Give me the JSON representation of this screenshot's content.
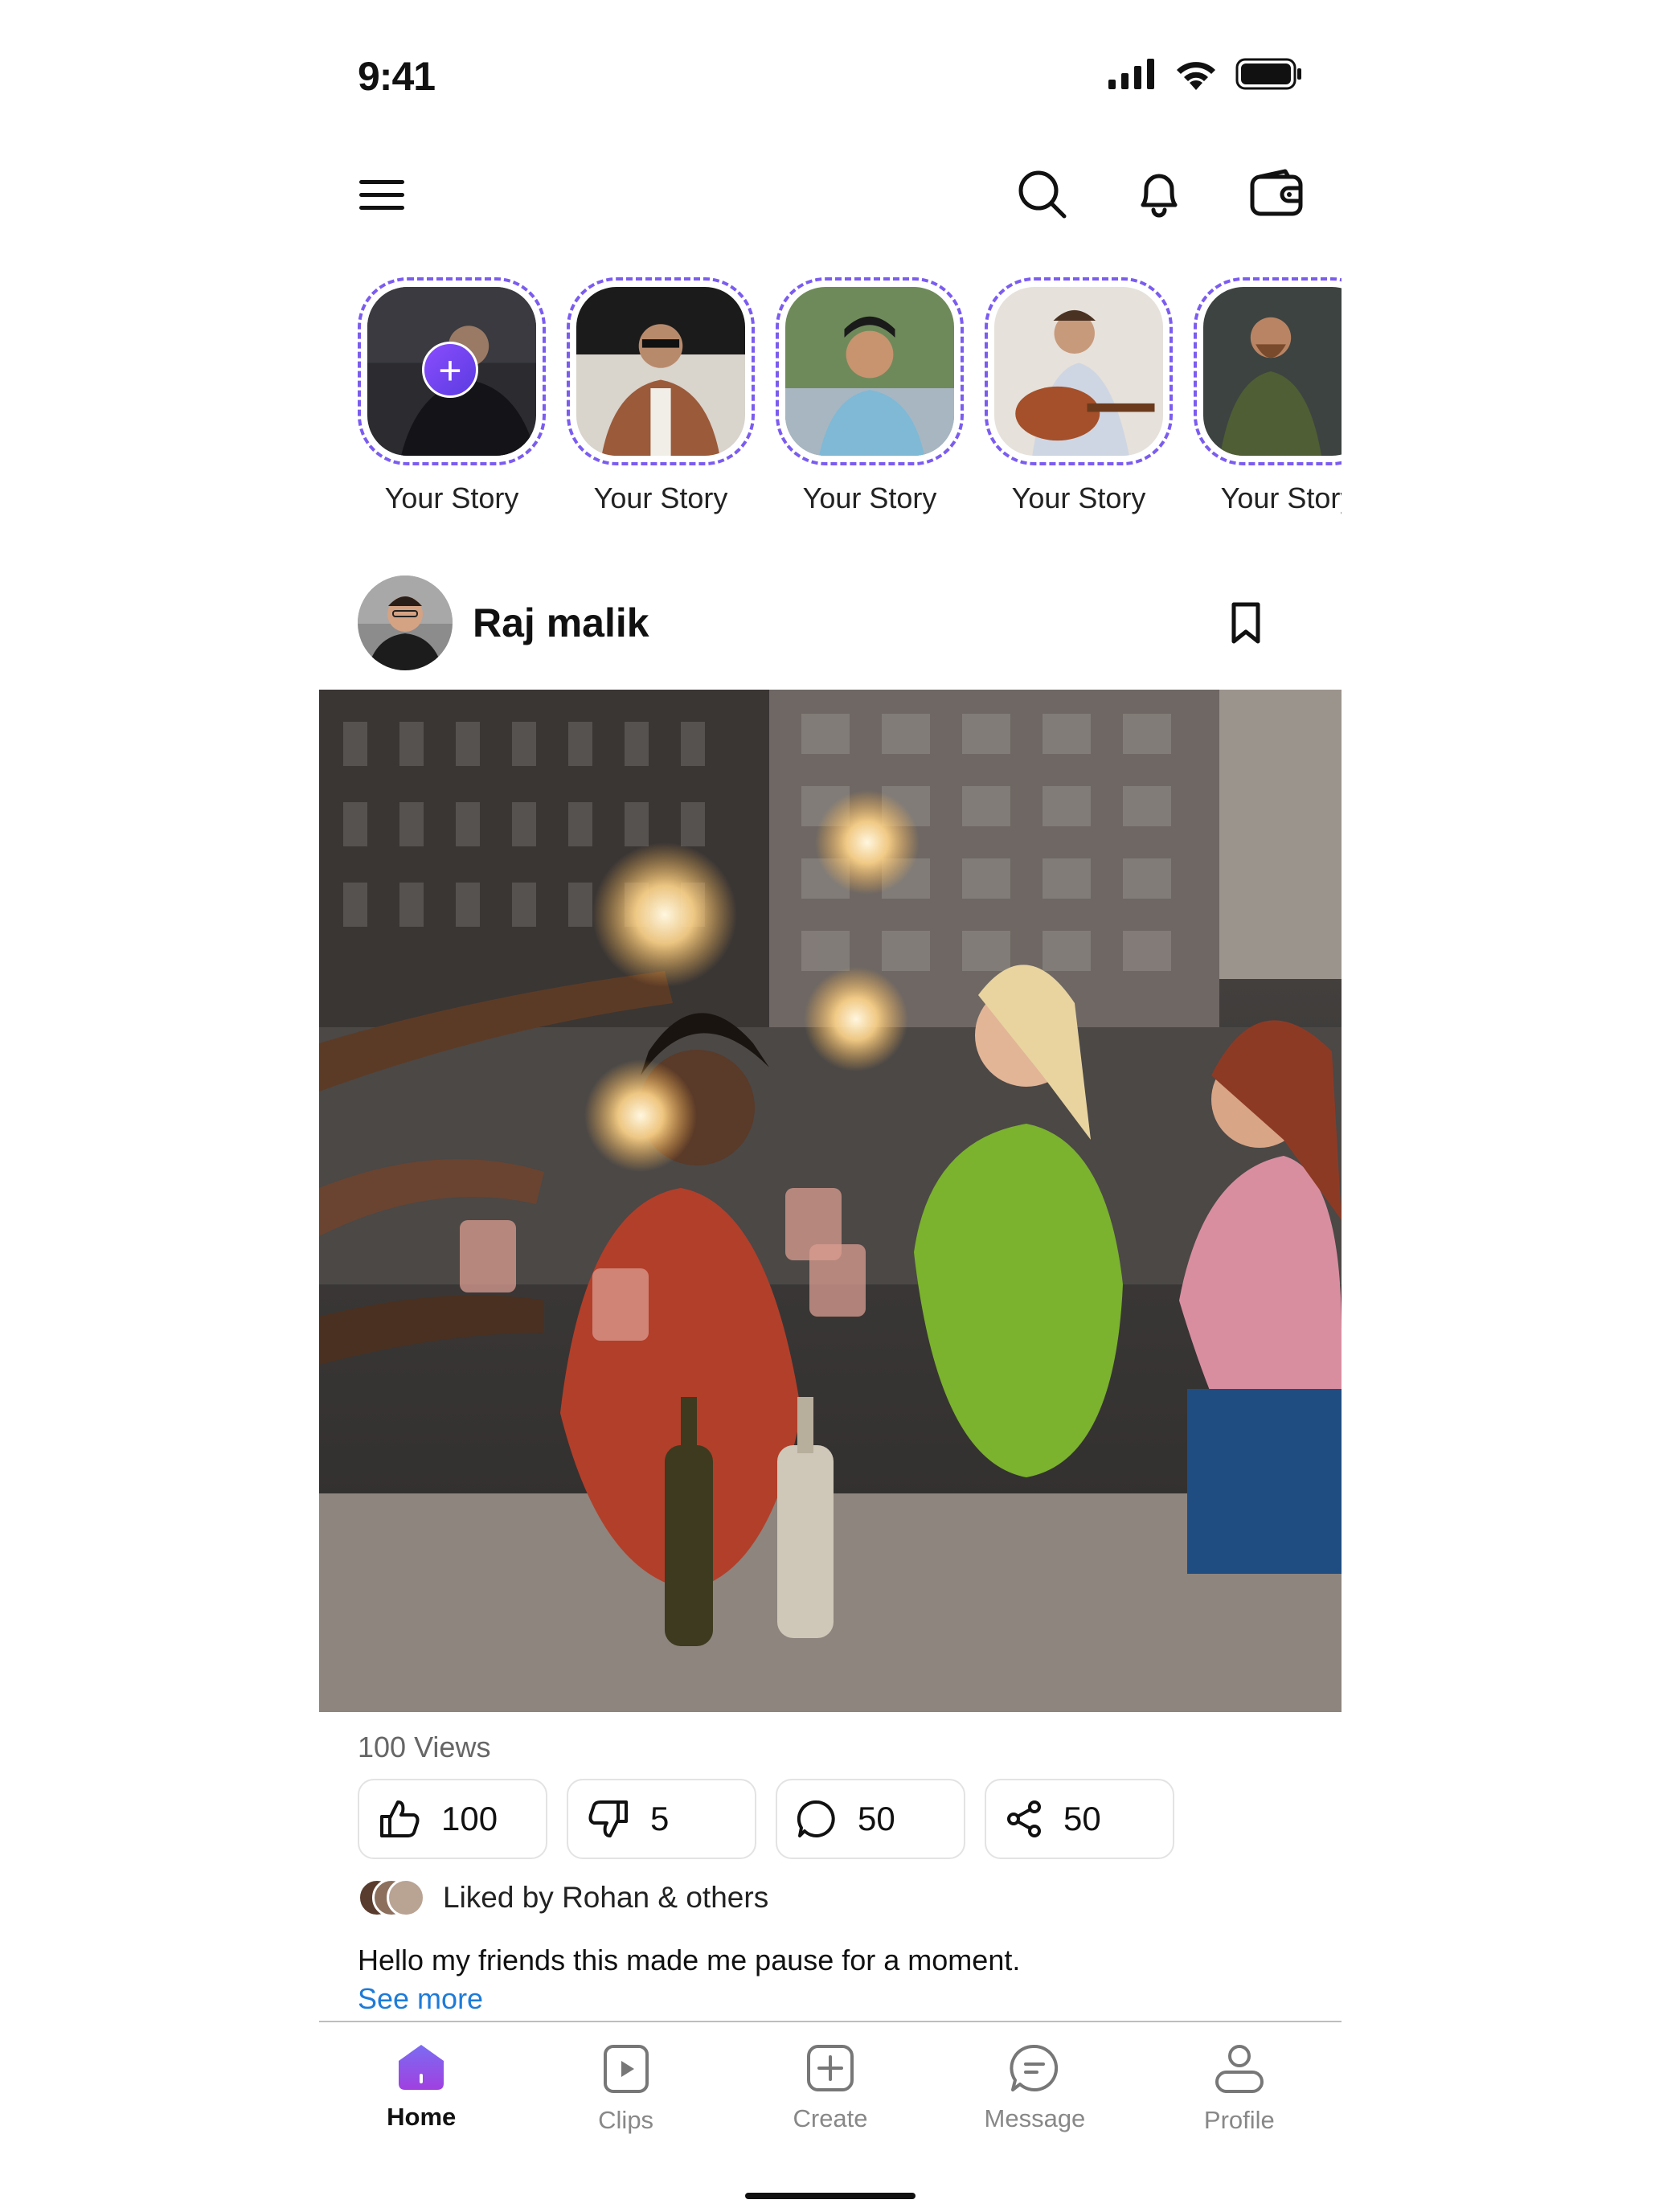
{
  "status_bar": {
    "time": "9:41",
    "icons": [
      "cellular-signal-icon",
      "wifi-icon",
      "battery-icon"
    ]
  },
  "header": {
    "icons": [
      "menu-icon",
      "search-icon",
      "bell-icon",
      "wallet-icon"
    ]
  },
  "stories": [
    {
      "label": "Your Story",
      "add": true
    },
    {
      "label": "Your Story"
    },
    {
      "label": "Your Story"
    },
    {
      "label": "Your Story"
    },
    {
      "label": "Your Story"
    }
  ],
  "post": {
    "author": "Raj malik",
    "views": "100 Views",
    "likes": "100",
    "dislikes": "5",
    "comments": "50",
    "shares": "50",
    "liked_by": "Liked by Rohan & others",
    "caption": "Hello my friends this made me pause for a moment.",
    "see_more": "See more"
  },
  "tabs": [
    {
      "label": "Home",
      "active": true
    },
    {
      "label": "Clips"
    },
    {
      "label": "Create"
    },
    {
      "label": "Message"
    },
    {
      "label": "Profile"
    }
  ],
  "colors": {
    "accent": "#7b5cf0",
    "link": "#1e7bd8",
    "home_gradient_top": "#7b6cf2",
    "home_gradient_bottom": "#a040e0"
  }
}
